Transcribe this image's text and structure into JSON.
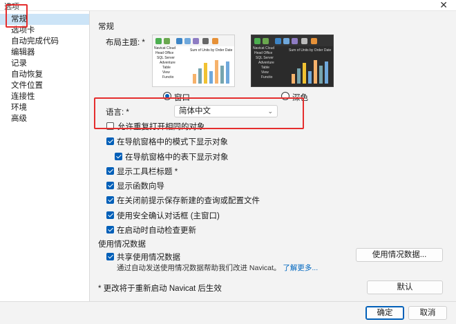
{
  "window": {
    "title": "选项",
    "close_glyph": "✕"
  },
  "sidebar": {
    "items": [
      {
        "label": "常规",
        "selected": true
      },
      {
        "label": "选项卡"
      },
      {
        "label": "自动完成代码"
      },
      {
        "label": "编辑器"
      },
      {
        "label": "记录"
      },
      {
        "label": "自动恢复"
      },
      {
        "label": "文件位置"
      },
      {
        "label": "连接性"
      },
      {
        "label": "环境"
      },
      {
        "label": "高级"
      }
    ]
  },
  "general": {
    "section_title": "常规",
    "layout_theme_label": "布局主题: *",
    "theme_preview": {
      "tree_items": [
        "Navicat Cloud",
        "Head Office",
        "SQL Server",
        "Adventure",
        "Table",
        "View",
        "Functio"
      ],
      "chart_title": "Sum of Units by Order Date"
    },
    "theme_options": [
      {
        "label": "窗口",
        "selected": true
      },
      {
        "label": "深色",
        "selected": false
      }
    ],
    "language_label": "语言: *",
    "language_value": "简体中文",
    "dropdown_icon": "chevron-down-icon",
    "allow_reopen_label": "允许重复打开相同的对象",
    "checkboxes": [
      {
        "label": "在导航窗格中的模式下显示对象",
        "checked": true
      },
      {
        "label": "在导航窗格中的表下显示对象",
        "checked": true
      },
      {
        "label": "显示工具栏标题 *",
        "checked": true
      },
      {
        "label": "显示函数向导",
        "checked": true
      },
      {
        "label": "在关闭前提示保存新建的查询或配置文件",
        "checked": true
      },
      {
        "label": "使用安全确认对话框 (主窗口)",
        "checked": true
      },
      {
        "label": "在启动时自动检查更新",
        "checked": true
      }
    ]
  },
  "usage": {
    "section_title": "使用情况数据",
    "share_label": "共享使用情况数据",
    "share_checked": true,
    "description": "通过自动发送使用情况数据帮助我们改进 Navicat。",
    "learn_more": "了解更多...",
    "data_button": "使用情况数据..."
  },
  "restart_note": "* 更改将于重新启动 Navicat 后生效",
  "default_button": "默认",
  "footer": {
    "ok": "确定",
    "cancel": "取消"
  },
  "colors": {
    "accent": "#005fb8",
    "selection": "#cce4f7",
    "annotation": "#e52d2d"
  }
}
